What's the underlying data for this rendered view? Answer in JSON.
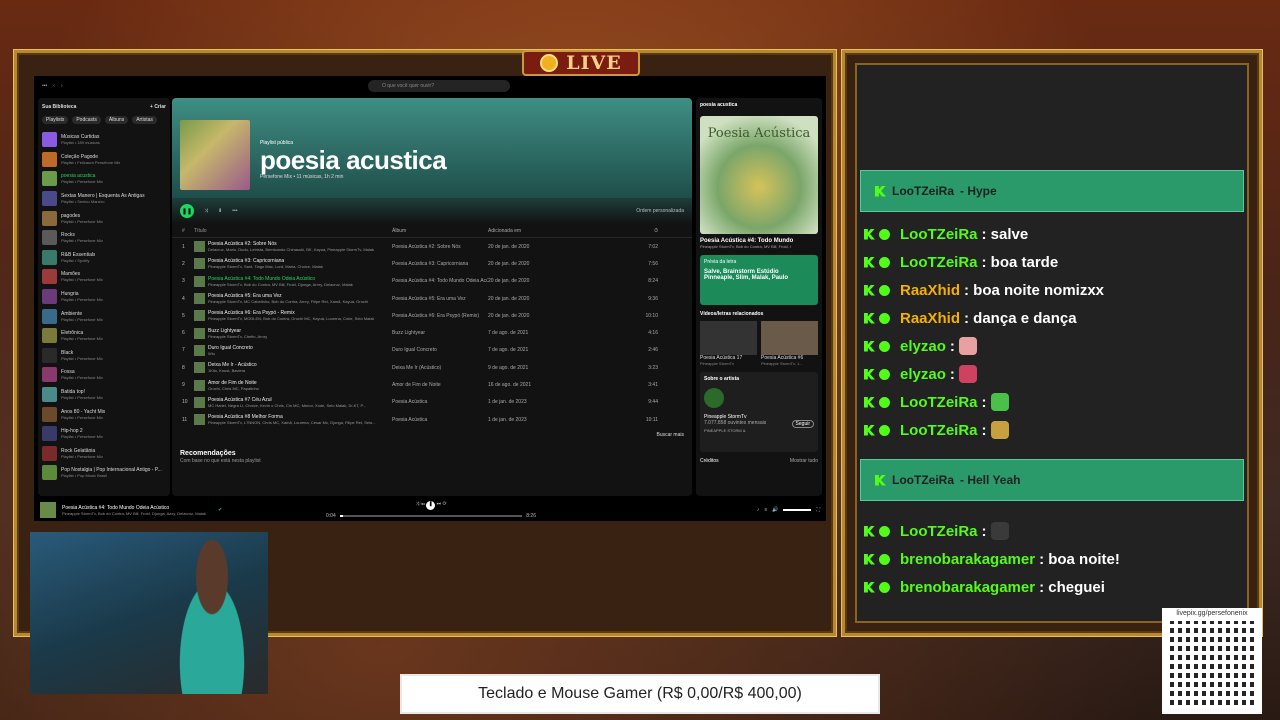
{
  "live_label": "LIVE",
  "spotify": {
    "search_placeholder": "O que você quer ouvir?",
    "library_title": "Sua Biblioteca",
    "create_label": "+ Criar",
    "chips": [
      "Playlists",
      "Podcasts",
      "Álbuns",
      "Artistas"
    ],
    "library": [
      {
        "t": "Músicas Curtidas",
        "s": "Playlist • 189 músicas"
      },
      {
        "t": "Coleção Pagode",
        "s": "Playlist • Felicaura Persefone Mix"
      },
      {
        "t": "poesia acustica",
        "s": "Playlist • Persefone Mix",
        "active": true
      },
      {
        "t": "Sextas Manero | Esquenta As Antigas",
        "s": "Playlist • Sextou Manero"
      },
      {
        "t": "pagodes",
        "s": "Playlist • Persefone Mix"
      },
      {
        "t": "Rocks",
        "s": "Playlist • Persefone Mix"
      },
      {
        "t": "R&B Essentials",
        "s": "Playlist • Spotify"
      },
      {
        "t": "Mamões",
        "s": "Playlist • Persefone Mix"
      },
      {
        "t": "Hungria",
        "s": "Playlist • Persefone Mix"
      },
      {
        "t": "Ambiente",
        "s": "Playlist • Persefone Mix"
      },
      {
        "t": "Eletrônica",
        "s": "Playlist • Persefone Mix"
      },
      {
        "t": "Black",
        "s": "Playlist • Persefone Mix"
      },
      {
        "t": "Fossa",
        "s": "Playlist • Persefone Mix"
      },
      {
        "t": "Batida top!",
        "s": "Playlist • Persefone Mix"
      },
      {
        "t": "Anos 80 - Yacht Mix",
        "s": "Playlist • Persefone Mix"
      },
      {
        "t": "Hip-hop 2",
        "s": "Playlist • Persefone Mix"
      },
      {
        "t": "Rock Gelatânia",
        "s": "Playlist • Persefone Mix"
      },
      {
        "t": "Pop Nostalgia | Pop Internacional Antigo - P...",
        "s": "Playlist • Pop Music Brasil"
      }
    ],
    "playlist_type": "Playlist pública",
    "playlist_title": "poesia acustica",
    "playlist_meta": "Persefone Mix • 11 músicas, 1h 2 min",
    "sort_label": "Ordem personalizada",
    "headers": {
      "n": "#",
      "title": "Título",
      "album": "Álbum",
      "date": "Adicionada em",
      "dur": "⏱"
    },
    "tracks": [
      {
        "n": "1",
        "t": "Poesia Acústica #2: Sobre Nós",
        "s": "Delacruz, Mario, Dudu, Letrista, Bemicando Chinasuki, BK, Kayuá, Pineapple StormTv, Malak",
        "a": "Poesia Acústica #2: Sobre Nós",
        "d": "20 de jan. de 2020",
        "du": "7:02"
      },
      {
        "n": "2",
        "t": "Poesia Acústica #3: Capricorniana",
        "s": "Pineapple StormTv, Sant, Tiago Mac, Lord, Maria, Choice, Malak",
        "a": "Poesia Acústica #3: Capricorniana",
        "d": "20 de jan. de 2020",
        "du": "7:56"
      },
      {
        "n": "3",
        "t": "Poesia Acústica #4: Todo Mundo Odeia Acústico",
        "s": "Pineapple StormTv, Bob do Contra, MV Bill, Froid, Djonga, Arnry, Delacruz, Malak",
        "a": "Poesia Acústica #4: Todo Mundo Odeia Acústi...",
        "d": "20 de jan. de 2020",
        "du": "8:24",
        "active": true
      },
      {
        "n": "4",
        "t": "Poesia Acústica #5: Era uma Vez",
        "s": "Pineapple StormTv, MC Cabelinho, Bob do Contra, Arnry, Filipe Ret, Xamã, Kayuá, Orochi",
        "a": "Poesia Acústica #5: Era uma Vez",
        "d": "20 de jan. de 2020",
        "du": "9:36"
      },
      {
        "n": "5",
        "t": "Poesia Acústica #6: Era Psypó - Remix",
        "s": "Pineapple StormTv, MODLEN, Bob do Contra, Orochi MC, Kayuá, Lourena, Coke, Selo Malak",
        "a": "Poesia Acústica #6: Era Psypó (Remix)",
        "d": "20 de jan. de 2020",
        "du": "10:10"
      },
      {
        "n": "6",
        "t": "Buzz Lightyear",
        "s": "Pineapple StormTv, Chefin, Arnry",
        "a": "Buzz Lightyear",
        "d": "7 de ago. de 2021",
        "du": "4:16"
      },
      {
        "n": "7",
        "t": "Duro Igual Concreto",
        "s": "Wiu",
        "a": "Duro Igual Concreto",
        "d": "7 de ago. de 2021",
        "du": "2:46"
      },
      {
        "n": "8",
        "t": "Deixa Me Ir - Acústico",
        "s": "1Kilo, Knust, Baviera",
        "a": "Deixa Me Ir (Acústico)",
        "d": "9 de ago. de 2021",
        "du": "3:23"
      },
      {
        "n": "9",
        "t": "Amor de Fim de Noite",
        "s": "Orochi, Chris MC, Papatinho",
        "a": "Amor de Fim de Noite",
        "d": "16 de ago. de 2021",
        "du": "3:41"
      },
      {
        "n": "10",
        "t": "Poesia Acústica #7 Céu Azul",
        "s": "MC Hariel, Negra Li, Choice, Kevin o Chris, Cin MC, Menor, Xóde, Selo Malak, Dí.KT, P...",
        "a": "Poesia Acústica",
        "d": "1 de jan. de 2023",
        "du": "9:44"
      },
      {
        "n": "11",
        "t": "Poesia Acústica #8 Melhor Forma",
        "s": "Pineapple StormTv, L7NNON, Chris MC, Xamã, Lourena, Cesar Mc, Djonga, Filipe Ret, Selo...",
        "a": "Poesia Acústica",
        "d": "1 de jan. de 2023",
        "du": "10:11"
      }
    ],
    "find_more": "Buscar mais",
    "rec_title": "Recomendações",
    "rec_sub": "Com base no que está nesta playlist",
    "side_header": "poesia acustica",
    "art_text": "Poesia Acústica",
    "now_title": "Poesia Acústica #4: Todo Mundo",
    "now_artists": "Pineapple StormTv, Bob do Contra, MV Bill, Froid, I",
    "lyrics_label": "Prévia da letra",
    "lyrics_line1": "Salve, Brainstorm Estúdio",
    "lyrics_line2": "Pinneaple, Slim, Malak, Paulo",
    "related_title": "Vídeos/letras relacionados",
    "related": [
      {
        "t": "Poesia Acústica 17",
        "s": "Pineapple StormTv"
      },
      {
        "t": "Poesia Acústica #6",
        "s": "Pineapple StormTv, 1..."
      }
    ],
    "about_title": "Sobre o artista",
    "artist_name": "Pineapple StormTv",
    "artist_listeners": "7.077.858 ouvintes mensais",
    "artist_desc": "PINEAPPLE STORM &",
    "follow_label": "Seguir",
    "credits_label": "Créditos",
    "credits_more": "Mostrar tudo",
    "bar_title": "Poesia Acústica #4: Todo Mundo Odeia Acústico",
    "bar_artists": "Pineapple StormTv, Bob do Contra, MV Bill, Froid, Djonga, Azzy, Delacruz, Malak",
    "time_now": "0:04",
    "time_total": "8:26"
  },
  "chat": {
    "hl1": {
      "u": "LooTZeiRa",
      "t": "- Hype"
    },
    "hl2": {
      "u": "LooTZeiRa",
      "t": "- Hell Yeah"
    },
    "messages": [
      {
        "u": "LooTZeiRa",
        "c": ": salve",
        "y": false
      },
      {
        "u": "LooTZeiRa",
        "c": ": boa tarde",
        "y": false
      },
      {
        "u": "RaaXhid",
        "c": ": boa noite nomizxx",
        "y": true
      },
      {
        "u": "RaaXhid",
        "c": ": dança e dança",
        "y": true
      },
      {
        "u": "elyzao",
        "c": ":",
        "y": false
      },
      {
        "u": "elyzao",
        "c": ":",
        "y": false
      },
      {
        "u": "LooTZeiRa",
        "c": ":",
        "y": false
      },
      {
        "u": "LooTZeiRa",
        "c": ":",
        "y": false
      },
      {
        "u": "LooTZeiRa",
        "c": ":",
        "y": false
      },
      {
        "u": "brenobarakagamer",
        "c": ": boa noite!",
        "y": false
      },
      {
        "u": "brenobarakagamer",
        "c": ": cheguei",
        "y": false
      }
    ]
  },
  "goal_text": "Teclado e Mouse Gamer (R$ 0,00/R$ 400,00)",
  "qr_url": "livepix.gg/persefonenix",
  "colors": {
    "kick_green": "#53fc18",
    "spotify_green": "#1ed760",
    "gold": "#b8882f",
    "yellow_user": "#f5b000"
  }
}
